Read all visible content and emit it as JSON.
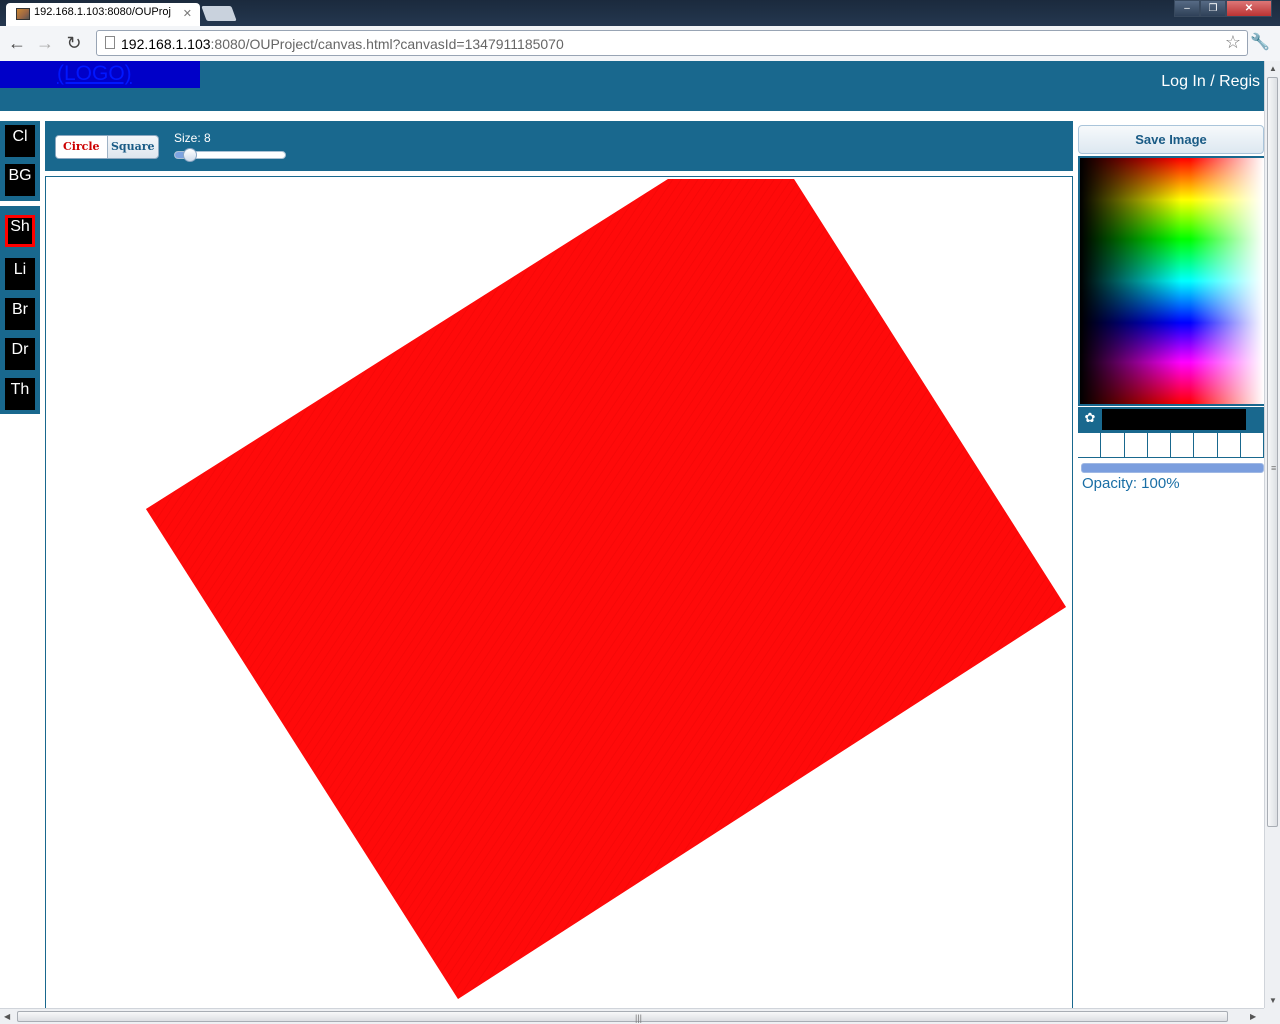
{
  "browser": {
    "tab_title": "192.168.1.103:8080/OUProj",
    "url_host": "192.168.1.103",
    "url_rest": ":8080/OUProject/canvas.html?canvasId=1347911185070"
  },
  "header": {
    "logo": "(LOGO)",
    "login": "Log In / Regis"
  },
  "sidebar": {
    "top": [
      "Cl",
      "BG"
    ],
    "bottom": [
      "Sh",
      "Li",
      "Br",
      "Dr",
      "Th"
    ],
    "selected": "Sh"
  },
  "toolbar": {
    "circle": "Circle",
    "square": "Square",
    "size_label": "Size: 8",
    "size_value": 8
  },
  "right_panel": {
    "save_label": "Save Image",
    "current_color": "#000000",
    "opacity_label": "Opacity: 100%",
    "opacity_value": 1.0
  },
  "colors": {
    "accent": "#19688e",
    "shape_fill": "#ff0a0a",
    "selected_border": "#ff0000"
  },
  "icons": [
    "back-icon",
    "forward-icon",
    "reload-icon",
    "page-icon",
    "star-icon",
    "wrench-icon",
    "palette-icon"
  ]
}
